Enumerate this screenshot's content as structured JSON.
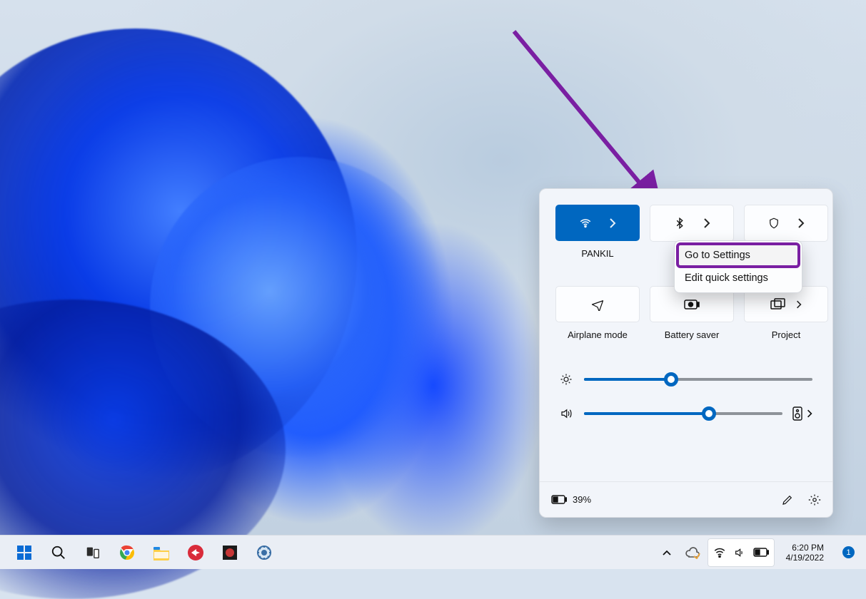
{
  "quick_settings": {
    "tiles": [
      {
        "id": "wifi",
        "label": "PANKIL",
        "active": true,
        "has_more": true
      },
      {
        "id": "bluetooth",
        "label": "",
        "has_more": true
      },
      {
        "id": "security",
        "label": "",
        "has_more": true
      },
      {
        "id": "airplane",
        "label": "Airplane mode"
      },
      {
        "id": "battery-saver",
        "label": "Battery saver"
      },
      {
        "id": "project",
        "label": "Project",
        "has_more": true
      }
    ],
    "context_menu": {
      "go_to_settings": "Go to Settings",
      "edit_quick": "Edit quick settings"
    },
    "brightness_pct": 38,
    "volume_pct": 63,
    "battery_text": "39%"
  },
  "taskbar": {
    "time": "6:20 PM",
    "date": "4/19/2022",
    "notification_count": "1"
  }
}
